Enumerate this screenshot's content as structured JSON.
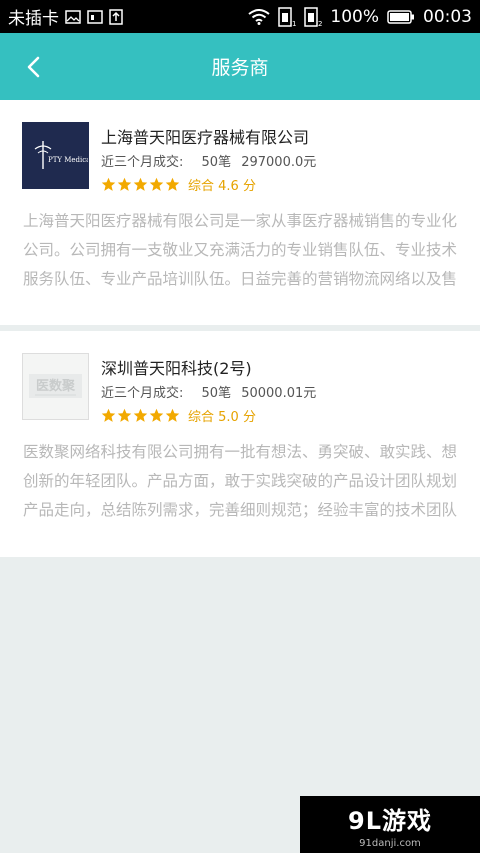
{
  "status_bar": {
    "carrier": "未插卡",
    "battery_pct": "100%",
    "time": "00:03"
  },
  "header": {
    "title": "服务商"
  },
  "providers": [
    {
      "name": "上海普天阳医疗器械有限公司",
      "stats_label": "近三个月成交:",
      "deals": "50笔",
      "amount": "297000.0元",
      "stars": 5,
      "score_text": "综合 4.6 分",
      "logo_text": "PTY Medical",
      "description": "上海普天阳医疗器械有限公司是一家从事医疗器械销售的专业化公司。公司拥有一支敬业又充满活力的专业销售队伍、专业技术服务队伍、专业产品培训队伍。日益完善的营销物流网络以及售"
    },
    {
      "name": "深圳普天阳科技(2号)",
      "stats_label": "近三个月成交:",
      "deals": "50笔",
      "amount": "50000.01元",
      "stars": 5,
      "score_text": "综合 5.0 分",
      "logo_text": "医数聚",
      "description": "医数聚网络科技有限公司拥有一批有想法、勇突破、敢实践、想创新的年轻团队。产品方面，敢于实践突破的产品设计团队规划产品走向，总结陈列需求，完善细则规范；经验丰富的技术团队"
    }
  ],
  "watermark": {
    "main": "9L游戏",
    "sub": "91danji.com"
  },
  "colors": {
    "header_bg": "#35c0c0",
    "star": "#f2a900",
    "desc_text": "#b8b8b8",
    "page_bg": "#e9eeee"
  }
}
